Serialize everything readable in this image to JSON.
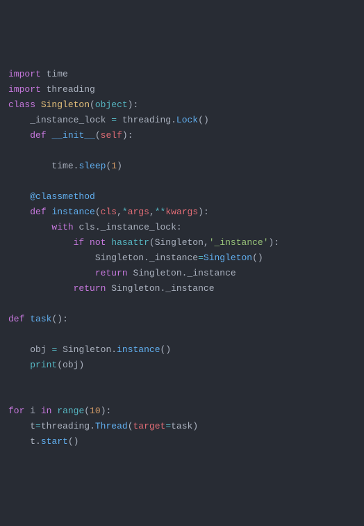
{
  "code": {
    "kw_import1": "import",
    "mod_time": "time",
    "kw_import2": "import",
    "mod_threading": "threading",
    "kw_class": "class",
    "cls_singleton": "Singleton",
    "base_object": "object",
    "attr_instance_lock": "_instance_lock",
    "eq": "=",
    "threading_ref": "threading",
    "dot": ".",
    "lock_call": "Lock",
    "kw_def1": "def",
    "init_name": "__init__",
    "self1": "self",
    "time_ref": "time",
    "sleep": "sleep",
    "num1": "1",
    "decorator": "@classmethod",
    "kw_def2": "def",
    "instance_fn": "instance",
    "cls_param": "cls",
    "comma": ",",
    "star": "*",
    "args": "args",
    "dstar": "**",
    "kwargs": "kwargs",
    "kw_with": "with",
    "cls_ref1": "cls",
    "instance_lock_attr": "_instance_lock",
    "kw_if": "if",
    "kw_not": "not",
    "hasattr": "hasattr",
    "singleton_ref1": "Singleton",
    "str_instance": "'_instance'",
    "singleton_ref2": "Singleton",
    "instance_attr1": "_instance",
    "singleton_ref3": "Singleton",
    "kw_return1": "return",
    "singleton_ref4": "Singleton",
    "instance_attr2": "_instance",
    "kw_return2": "return",
    "singleton_ref5": "Singleton",
    "instance_attr3": "_instance",
    "kw_def3": "def",
    "task_fn": "task",
    "obj_var": "obj",
    "singleton_ref6": "Singleton",
    "instance_call": "instance",
    "print_fn": "print",
    "obj_arg": "obj",
    "kw_for": "for",
    "i_var": "i",
    "kw_in": "in",
    "range_fn": "range",
    "num10": "10",
    "t_var": "t",
    "threading_ref2": "threading",
    "thread_cls": "Thread",
    "target_kw": "target",
    "task_ref": "task",
    "t_var2": "t",
    "start_fn": "start",
    "lp": "(",
    "rp": ")",
    "colon": ":"
  }
}
